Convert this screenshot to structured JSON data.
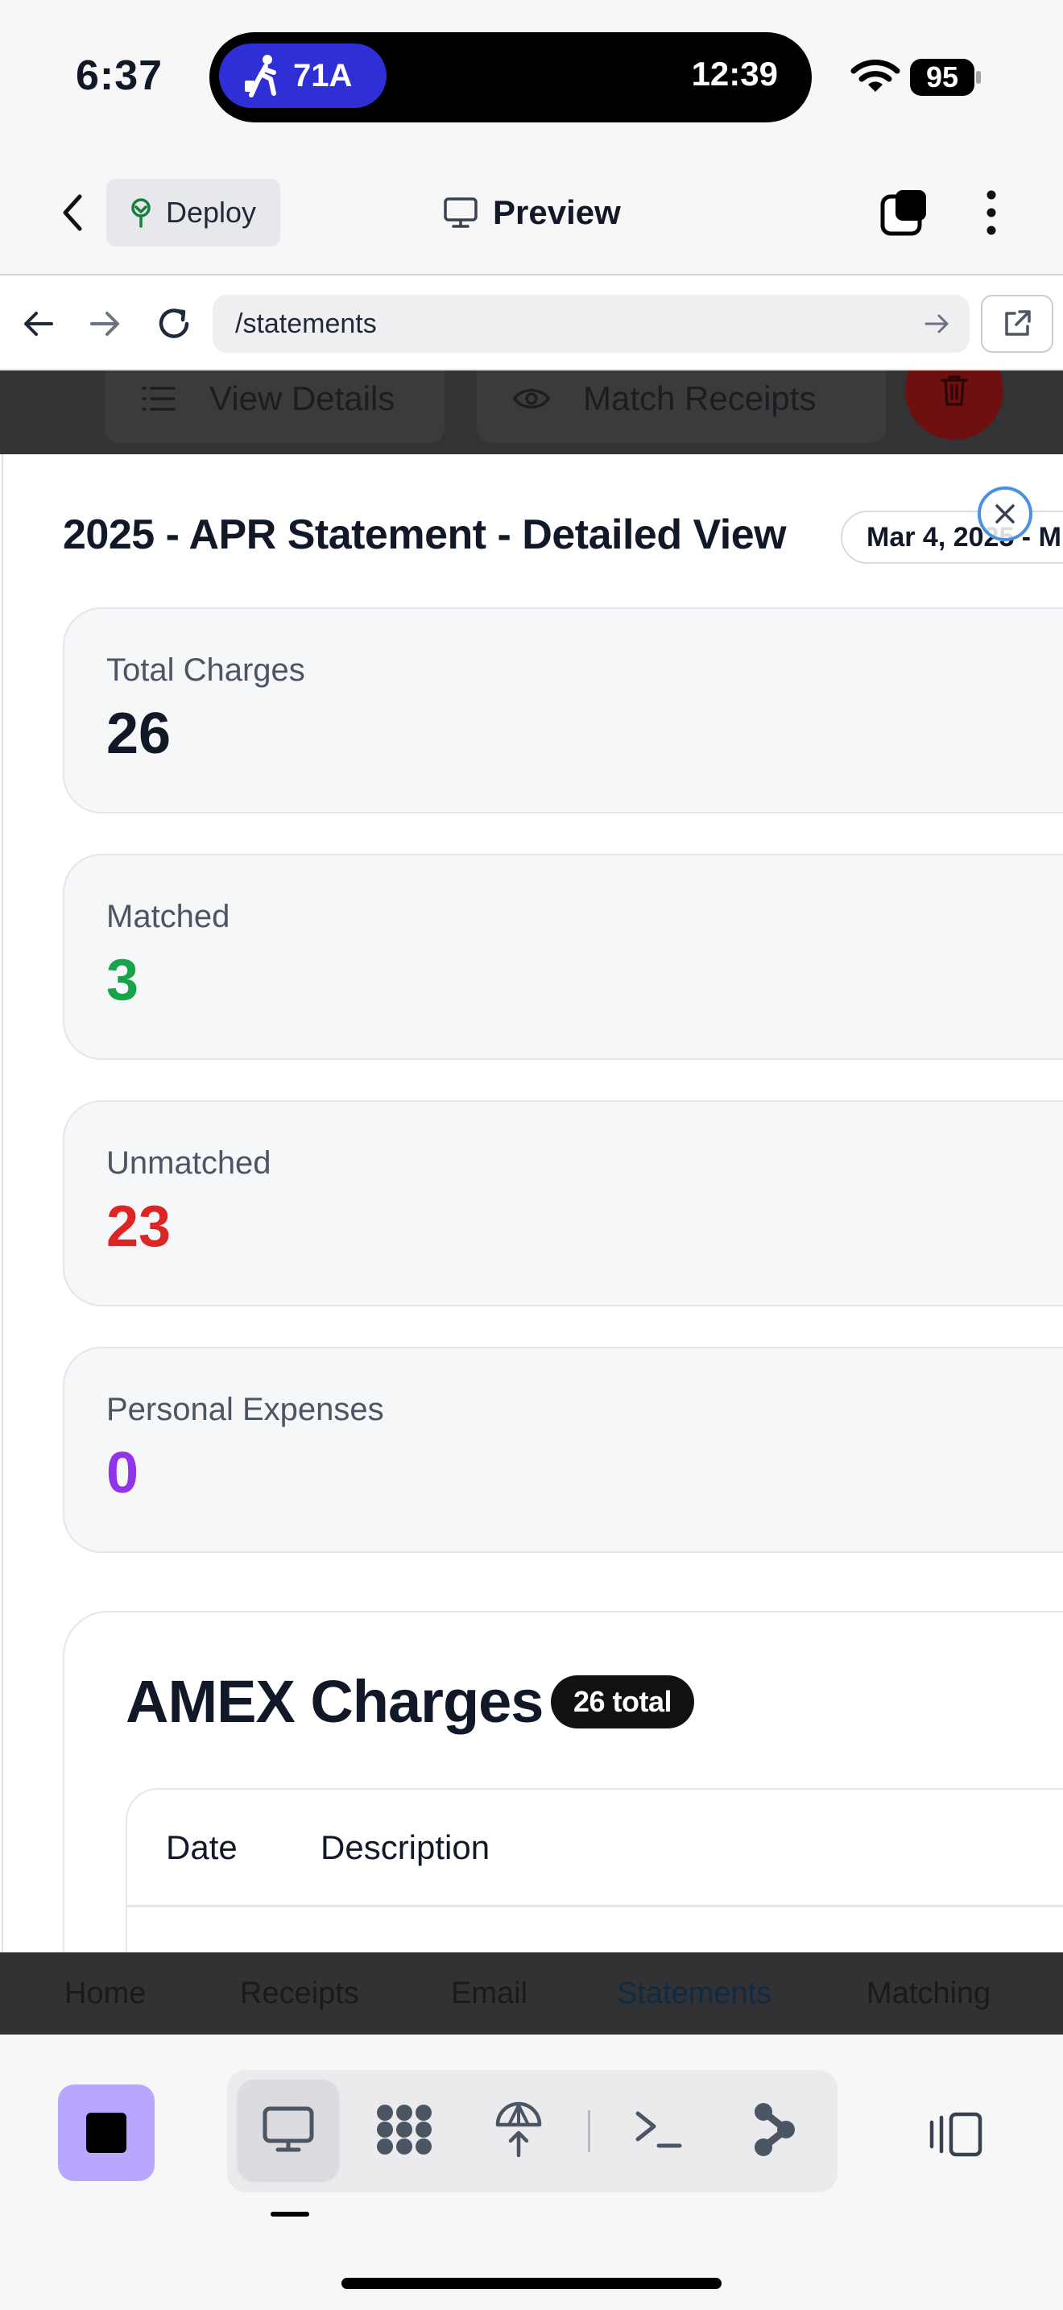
{
  "status_bar": {
    "time": "6:37",
    "activity_route": "71A",
    "activity_time": "12:39",
    "battery": "95",
    "activity_color": "#2f2fd8"
  },
  "top_bar": {
    "deploy_label": "Deploy",
    "preview_label": "Preview"
  },
  "url_bar": {
    "url": "/statements"
  },
  "background_actions": {
    "view_details": "View Details",
    "match_receipts": "Match Receipts"
  },
  "modal": {
    "title": "2025 - APR Statement - Detailed View",
    "date_range": "Mar 4, 2025 - M",
    "stats": [
      {
        "label": "Total Charges",
        "value": "26",
        "color": "#111827"
      },
      {
        "label": "Matched",
        "value": "3",
        "color": "#16a34a"
      },
      {
        "label": "Unmatched",
        "value": "23",
        "color": "#dc2626"
      },
      {
        "label": "Personal Expenses",
        "value": "0",
        "color": "#9333ea"
      }
    ],
    "charges": {
      "title": "AMEX Charges",
      "badge": "26 total",
      "columns": [
        "Date",
        "Description"
      ]
    }
  },
  "app_tabs": {
    "items": [
      "Home",
      "Receipts",
      "Email",
      "Statements",
      "Matching"
    ],
    "active": "Statements"
  },
  "dock": {
    "stop_color": "#b9a6ff",
    "tools": [
      "preview-icon",
      "apps-icon",
      "deploy-icon",
      "shell-icon",
      "git-icon"
    ]
  }
}
